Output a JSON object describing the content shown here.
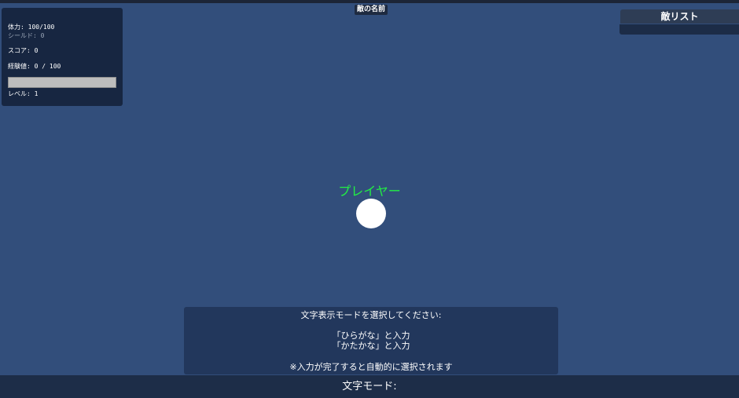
{
  "hud": {
    "enemy_name_tag": "敵の名前",
    "stats": {
      "hp_label": "体力: ",
      "hp_value": "100/100",
      "shield_label": "シールド: ",
      "shield_value": "0",
      "score_label": "スコア: ",
      "score_value": "0",
      "exp_label": "経験値: ",
      "exp_value": "0 / 100",
      "exp_progress": 0,
      "level_label": "レベル: ",
      "level_value": "1"
    },
    "enemy_list": {
      "title": "敵リスト",
      "items": []
    }
  },
  "player": {
    "label": "プレイヤー",
    "label_color": "#22ee44",
    "icon": "white-circle-sprite"
  },
  "mode_dialog": {
    "prompt": "文字表示モードを選択してください:",
    "option_hiragana": "「ひらがな」と入力",
    "option_katakana": "「かたかな」と入力",
    "note": "※入力が完了すると自動的に選択されます"
  },
  "input_bar": {
    "label": "文字モード:",
    "typed_text": ""
  },
  "colors": {
    "background": "#324e7b",
    "panel": "#172641",
    "dialog": "#22375c"
  }
}
